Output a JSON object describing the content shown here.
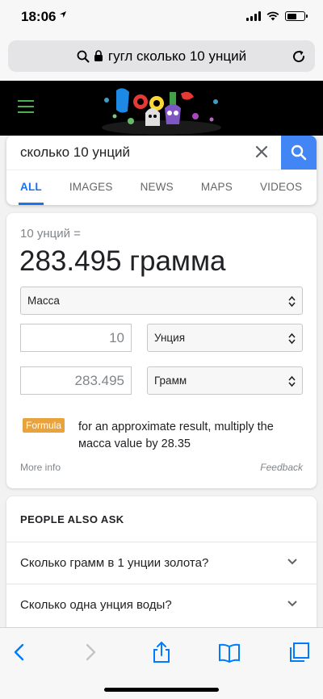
{
  "status": {
    "time": "18:06"
  },
  "browser": {
    "url_text": "гугл сколько 10 унций"
  },
  "search": {
    "query": "сколько 10 унций",
    "tabs": [
      {
        "label": "ALL",
        "active": true
      },
      {
        "label": "IMAGES"
      },
      {
        "label": "NEWS"
      },
      {
        "label": "MAPS"
      },
      {
        "label": "VIDEOS"
      }
    ]
  },
  "converter": {
    "subtitle": "10 унций =",
    "result": "283.495 грамма",
    "quantity": "Масса",
    "from_value": "10",
    "from_unit": "Унция",
    "to_value": "283.495",
    "to_unit": "Грамм",
    "formula_badge": "Formula",
    "formula_text": "for an approximate result, multiply the масса value by 28.35",
    "more_info": "More info",
    "feedback": "Feedback"
  },
  "people_also_ask": {
    "title": "PEOPLE ALSO ASK",
    "questions": [
      "Сколько грамм в 1 унции золота?",
      "Сколько одна унция воды?"
    ]
  },
  "colors": {
    "accent_blue": "#1a73e8",
    "search_button": "#4285f4",
    "formula_badge": "#e8a33d",
    "hamburger_green": "#4caf50"
  },
  "icons": {
    "toolbar": [
      "back-icon",
      "forward-icon",
      "share-icon",
      "bookmarks-icon",
      "tabs-icon"
    ]
  }
}
